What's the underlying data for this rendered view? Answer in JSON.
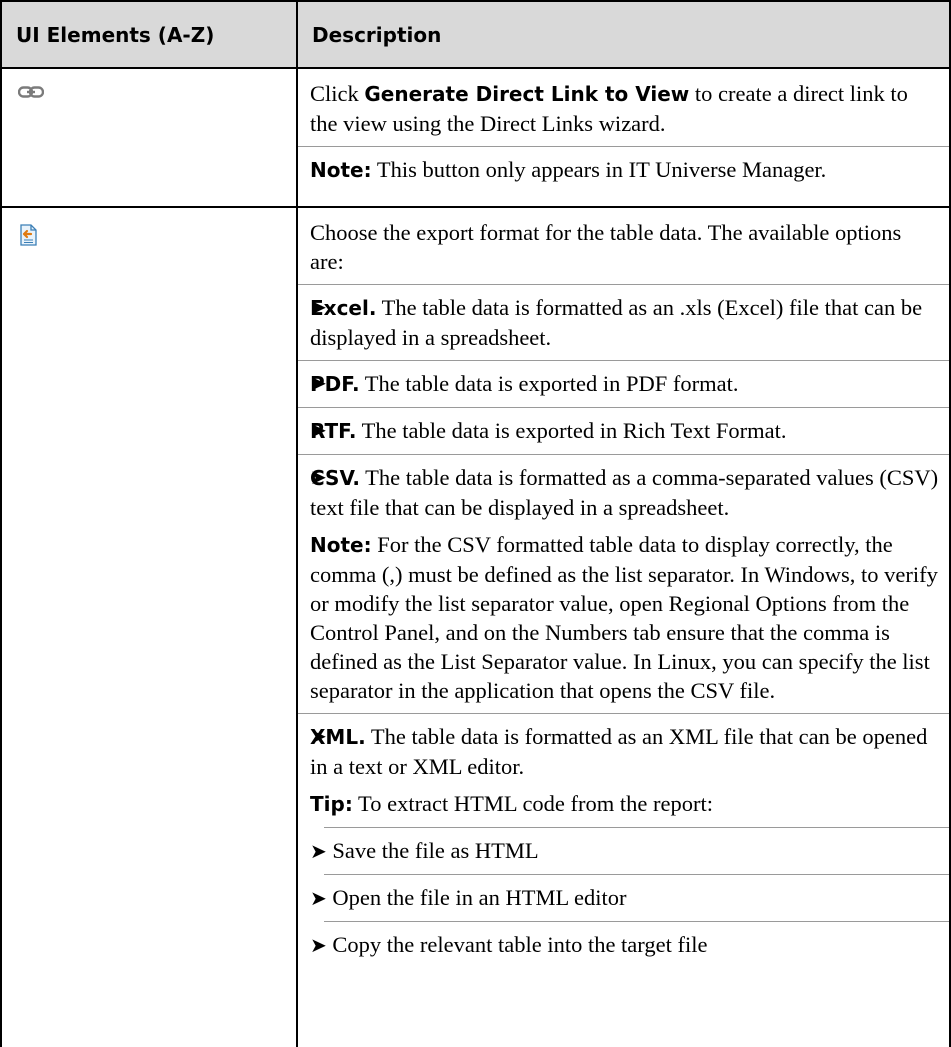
{
  "header": {
    "col1": "UI Elements (A-Z)",
    "col2": "Description"
  },
  "rows": [
    {
      "icon": "chain-link-icon",
      "intro": {
        "pre": "Click ",
        "bold": "Generate Direct Link to View",
        "post": " to create a direct link to the view using the Direct Links wizard."
      },
      "note": {
        "label": "Note:",
        "text": " This button only appears in IT Universe Manager."
      }
    },
    {
      "icon": "export-document-icon",
      "intro": "Choose the export format for the table data. The available options are:",
      "options": [
        {
          "label": "Excel.",
          "text": " The table data is formatted as an .xls (Excel) file that can be displayed in a spreadsheet."
        },
        {
          "label": "PDF.",
          "text": " The table data is exported in PDF format."
        },
        {
          "label": "RTF.",
          "text": " The table data is exported in Rich Text Format."
        },
        {
          "label": "CSV.",
          "text": " The table data is formatted as a comma-separated values (CSV) text file that can be displayed in a spreadsheet."
        },
        {
          "label": "XML.",
          "text": " The table data is formatted as an XML file that can be opened in a text or XML editor."
        }
      ],
      "csv_note": {
        "label": "Note:",
        "text": " For the CSV formatted table data to display correctly, the comma (,) must be defined as the list separator. In Windows, to verify or modify the list separator value, open Regional Options from the Control Panel, and on the Numbers tab ensure that the comma is defined as the List Separator value. In Linux, you can specify the list separator in the application that opens the CSV file."
      },
      "tip": {
        "label": "Tip:",
        "text": " To extract HTML code from the report:",
        "steps": [
          "Save the file as HTML",
          "Open the file in an HTML editor",
          "Copy the relevant table into the target file"
        ]
      }
    }
  ],
  "bullet_glyph": "➤"
}
